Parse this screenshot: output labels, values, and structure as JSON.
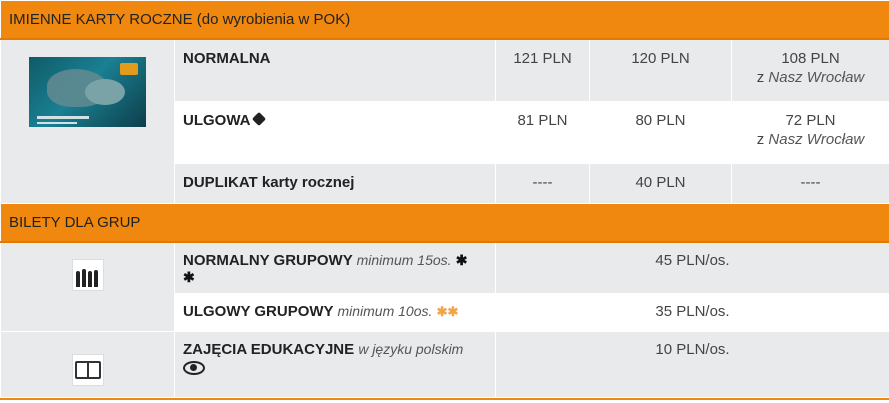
{
  "section1": {
    "title": "IMIENNE KARTY ROCZNE (do wyrobienia w POK)",
    "rows": [
      {
        "name": "NORMALNA",
        "p1": "121 PLN",
        "p2": "120 PLN",
        "p3": "108 PLN",
        "p3_prefix": "z",
        "p3_note": "Nasz Wrocław"
      },
      {
        "name": "ULGOWA",
        "p1": "81 PLN",
        "p2": "80 PLN",
        "p3": "72 PLN",
        "p3_prefix": "z",
        "p3_note": "Nasz Wrocław"
      },
      {
        "name": "DUPLIKAT karty rocznej",
        "p1": "----",
        "p2": "40 PLN",
        "p3": "----"
      }
    ]
  },
  "section2": {
    "title": "BILETY DLA GRUP",
    "rows": [
      {
        "name": "NORMALNY GRUPOWY",
        "note": "minimum 15os.",
        "price": "45 PLN/os."
      },
      {
        "name": "ULGOWY GRUPOWY",
        "note": "minimum 10os.",
        "price": "35 PLN/os."
      },
      {
        "name": "ZAJĘCIA EDUKACYJNE",
        "note": "w języku polskim",
        "price": "10 PLN/os."
      }
    ]
  },
  "colors": {
    "header_bg": "#f0870e",
    "row_grey": "#e8eaeb",
    "star_orange": "#f0a54a"
  },
  "icons": [
    "seal-card-image",
    "price-tag-icon",
    "star-icon",
    "group-people-icon",
    "book-icon",
    "eye-icon"
  ]
}
